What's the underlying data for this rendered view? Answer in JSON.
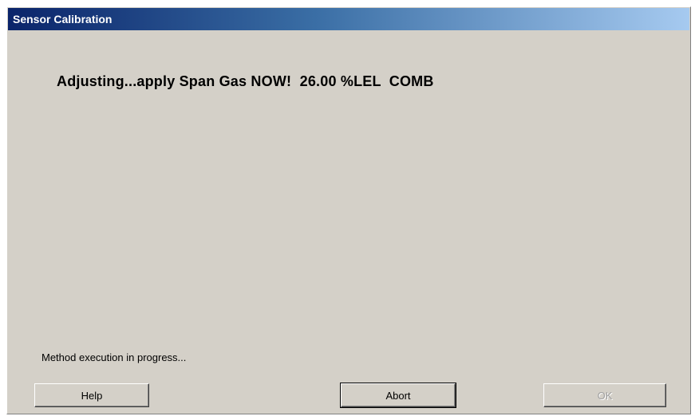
{
  "window": {
    "title": "Sensor Calibration"
  },
  "main": {
    "message": "Adjusting...apply Span Gas NOW!  26.00 %LEL  COMB",
    "status": "Method execution in progress..."
  },
  "buttons": {
    "help_label": "Help",
    "abort_label": "Abort",
    "ok_label": "OK",
    "ok_enabled": false
  },
  "colors": {
    "title_gradient_start": "#0a246a",
    "title_gradient_end": "#a6caf0",
    "dialog_background": "#d4d0c8"
  }
}
